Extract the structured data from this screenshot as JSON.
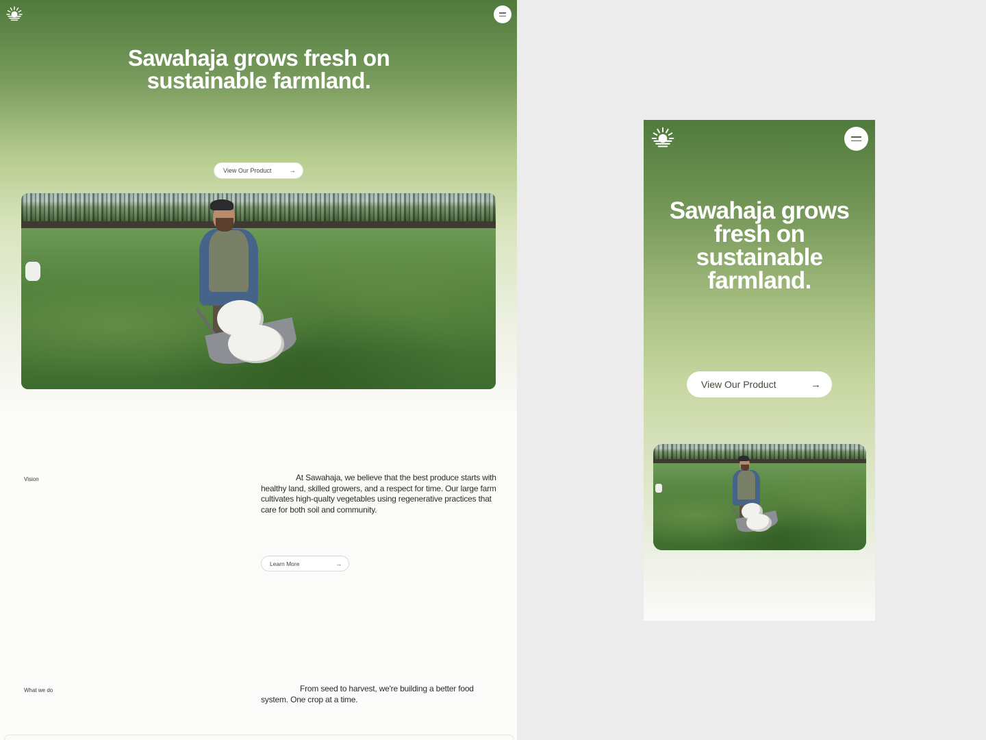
{
  "desktop": {
    "logo_icon": "sun-over-water-logo",
    "menu_icon": "menu-icon",
    "hero": {
      "title": "Sawahaja grows fresh on sustainable farmland.",
      "cta_label": "View Our Product",
      "cta_icon": "arrow-right-icon"
    },
    "hero_image": "farmer-pushing-wheelbarrow-in-carrot-field",
    "vision": {
      "label": "Vision",
      "text": "At Sawahaja, we believe that the best produce starts with healthy land, skilled growers, and a respect for time. Our large farm cultivates high-qualty vegetables using regenerative practices that care for both soil and community.",
      "cta_label": "Learn More",
      "cta_icon": "arrow-right-icon"
    },
    "what_we_do": {
      "label": "What we do",
      "text": "From seed to harvest, we're building a better food system. One crop at a time."
    }
  },
  "mobile": {
    "logo_icon": "sun-over-water-logo",
    "menu_icon": "menu-icon",
    "hero": {
      "title": "Sawahaja grows fresh on sustainable farmland.",
      "cta_label": "View Our Product",
      "cta_icon": "arrow-right-icon"
    },
    "hero_image": "farmer-pushing-wheelbarrow-in-carrot-field"
  },
  "glyphs": {
    "arrow": "→"
  },
  "colors": {
    "hero_green_top": "#4f7a3c",
    "hero_green_light": "#c6d6a0",
    "page_background": "#fbfbfa",
    "canvas_background": "#ececec",
    "button_text": "#3f4a38"
  }
}
